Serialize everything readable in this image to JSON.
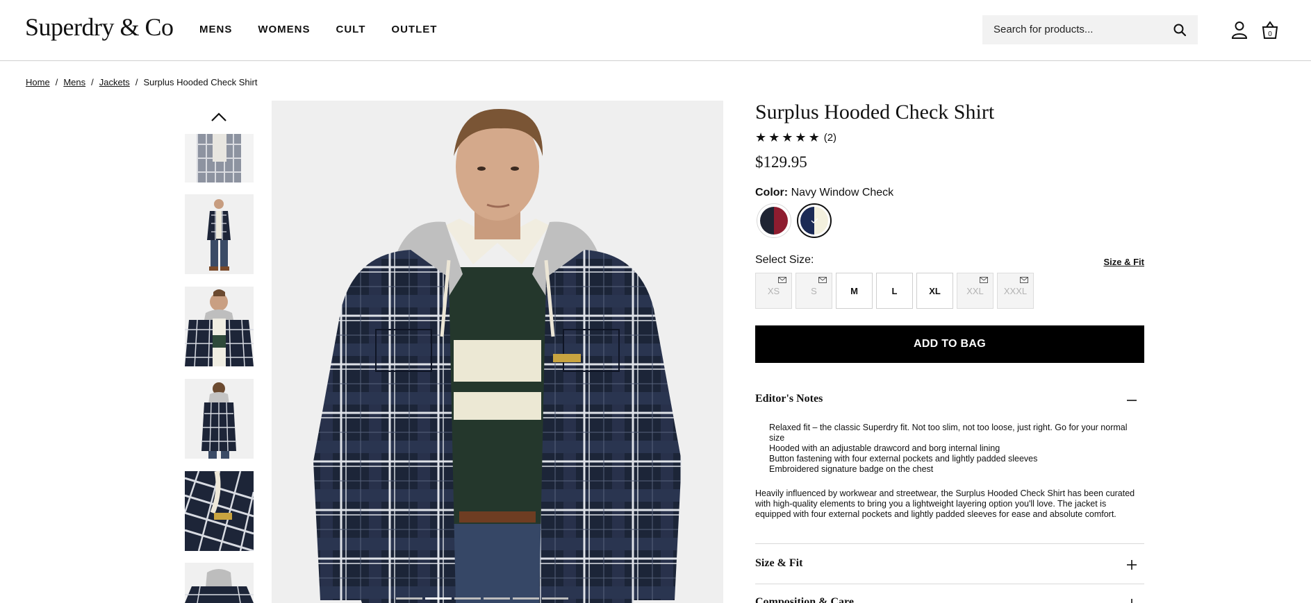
{
  "header": {
    "logo": "Superdry & Co",
    "nav": [
      "MENS",
      "WOMENS",
      "CULT",
      "OUTLET"
    ],
    "search_placeholder": "Search for products...",
    "bag_count": "0"
  },
  "breadcrumb": {
    "items": [
      "Home",
      "Mens",
      "Jackets"
    ],
    "current": "Surplus Hooded Check Shirt"
  },
  "product": {
    "title": "Surplus Hooded Check Shirt",
    "rating": 5,
    "rating_count": "(2)",
    "price": "$129.95",
    "color_label": "Color:",
    "color_value": "Navy Window Check",
    "swatches": [
      {
        "name": "Navy/Burgundy",
        "colors": [
          "#1f2433",
          "#8e1c2f"
        ],
        "selected": false
      },
      {
        "name": "Navy Window Check",
        "colors": [
          "#1b2a55",
          "#f3f0de"
        ],
        "selected": true
      }
    ],
    "size_label": "Select Size:",
    "size_fit_link": "Size & Fit",
    "sizes": [
      {
        "label": "XS",
        "available": false
      },
      {
        "label": "S",
        "available": false
      },
      {
        "label": "M",
        "available": true
      },
      {
        "label": "L",
        "available": true
      },
      {
        "label": "XL",
        "available": true
      },
      {
        "label": "XXL",
        "available": false
      },
      {
        "label": "XXXL",
        "available": false
      }
    ],
    "add_to_bag": "ADD TO BAG"
  },
  "accordion": {
    "editors_notes_title": "Editor's Notes",
    "editors_notes_bullets": [
      "Relaxed fit – the classic Superdry fit. Not too slim, not too loose, just right. Go for your normal size",
      "Hooded with an adjustable drawcord and borg internal lining",
      "Button fastening with four external pockets and lightly padded sleeves",
      "Embroidered signature badge on the chest"
    ],
    "editors_notes_description": "Heavily influenced by workwear and streetwear, the Surplus Hooded Check Shirt has been curated with high-quality elements to bring you a lightweight layering option you'll love. The jacket is equipped with four external pockets and lightly padded sleeves for ease and absolute comfort.",
    "size_fit_title": "Size & Fit",
    "composition_title": "Composition & Care"
  },
  "gallery": {
    "active_index": 1,
    "count": 7
  },
  "colors": {
    "navy": "#1c2538",
    "hood_grey": "#c9c9c9",
    "button_black": "#000000"
  }
}
